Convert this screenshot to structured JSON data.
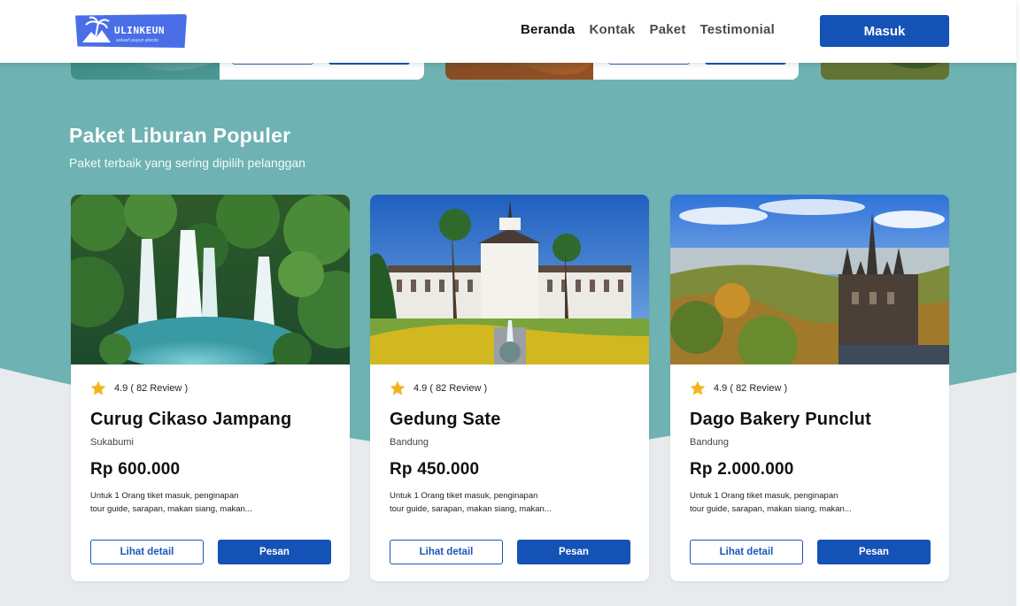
{
  "brand": {
    "name": "ULINKEUN",
    "tagline": "sekeeh pupun alresto"
  },
  "nav": {
    "items": [
      "Beranda",
      "Kontak",
      "Paket",
      "Testimonial"
    ],
    "active": "Beranda",
    "login_label": "Masuk"
  },
  "section": {
    "title": "Paket Liburan Populer",
    "subtitle": "Paket terbaik yang sering dipilih pelanggan"
  },
  "packages": [
    {
      "rating": "4.9 ( 82 Review )",
      "title": "Curug Cikaso Jampang",
      "city": "Sukabumi",
      "price": "Rp 600.000",
      "desc_line1": "Untuk 1 Orang tiket masuk, penginapan",
      "desc_line2": "tour guide, sarapan, makan siang, makan...",
      "detail_label": "Lihat detail",
      "order_label": "Pesan"
    },
    {
      "rating": "4.9 ( 82 Review )",
      "title": "Gedung Sate",
      "city": "Bandung",
      "price": "Rp 450.000",
      "desc_line1": "Untuk 1 Orang tiket masuk, penginapan",
      "desc_line2": "tour guide, sarapan, makan siang, makan...",
      "detail_label": "Lihat detail",
      "order_label": "Pesan"
    },
    {
      "rating": "4.9 ( 82 Review )",
      "title": "Dago Bakery Punclut",
      "city": "Bandung",
      "price": "Rp 2.000.000",
      "desc_line1": "Untuk 1 Orang tiket masuk, penginapan",
      "desc_line2": "tour guide, sarapan, makan siang, makan...",
      "detail_label": "Lihat detail",
      "order_label": "Pesan"
    }
  ],
  "colors": {
    "primary": "#1452b6",
    "teal": "#6db2b4",
    "background": "#e7ebee",
    "star": "#f5b41e"
  }
}
